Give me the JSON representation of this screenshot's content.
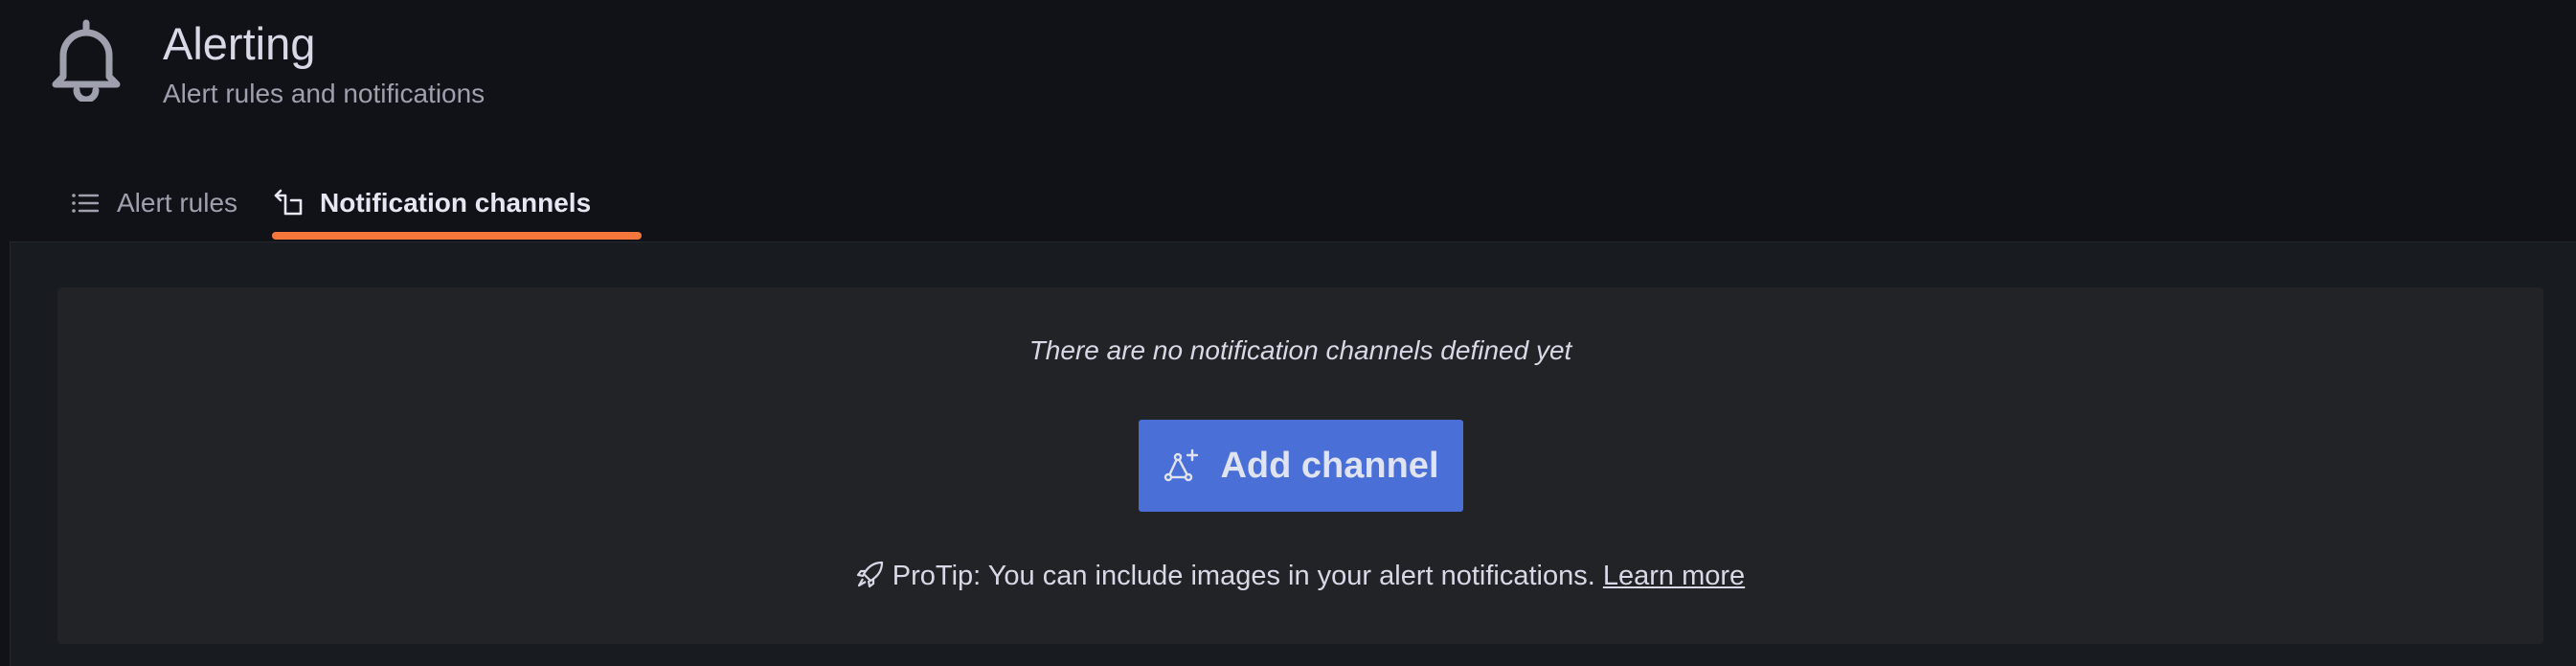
{
  "header": {
    "icon": "bell-icon",
    "title": "Alerting",
    "subtitle": "Alert rules and notifications"
  },
  "tabs": [
    {
      "label": "Alert rules",
      "icon": "list-icon",
      "active": false
    },
    {
      "label": "Notification channels",
      "icon": "channel-icon",
      "active": true
    }
  ],
  "empty_state": {
    "message": "There are no notification channels defined yet",
    "button_label": "Add channel",
    "button_icon": "add-channel-icon",
    "protip_icon": "rocket-icon",
    "protip_text": "ProTip: You can include images in your alert notifications.",
    "protip_link": "Learn more"
  },
  "colors": {
    "background": "#111217",
    "panel": "#222327",
    "active_tab_underline": "#f5773c",
    "primary_button": "#4a6fd6"
  }
}
